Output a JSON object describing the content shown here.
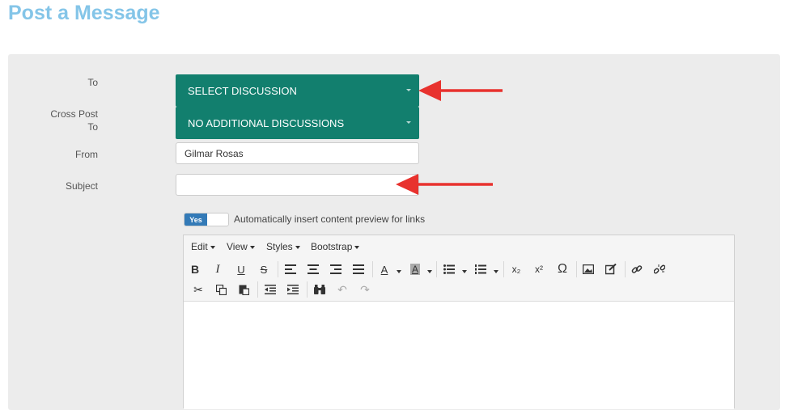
{
  "page": {
    "title": "Post a Message"
  },
  "form": {
    "to_label": "To",
    "cross_post_label_line1": "Cross Post",
    "cross_post_label_line2": "To",
    "from_label": "From",
    "subject_label": "Subject",
    "to_select": "SELECT DISCUSSION",
    "cross_post_select": "NO ADDITIONAL DISCUSSIONS",
    "from_value": "Gilmar Rosas",
    "subject_value": "",
    "toggle_on_label": "Yes",
    "toggle_caption": "Automatically insert content preview for links"
  },
  "editor": {
    "menus": [
      "Edit",
      "View",
      "Styles",
      "Bootstrap"
    ],
    "toolbar_row1": [
      "bold-icon",
      "italic-icon",
      "underline-icon",
      "strikethrough-icon",
      "align-left-icon",
      "align-center-icon",
      "align-right-icon",
      "align-justify-icon",
      "text-color-icon",
      "background-color-icon",
      "bullet-list-icon",
      "numbered-list-icon",
      "subscript-icon",
      "superscript-icon",
      "special-character-icon",
      "image-icon",
      "edit-source-icon",
      "link-icon",
      "unlink-icon"
    ],
    "toolbar_row2": [
      "cut-icon",
      "copy-icon",
      "paste-icon",
      "outdent-icon",
      "indent-icon",
      "find-icon",
      "undo-icon",
      "redo-icon"
    ],
    "glyphs": {
      "bold": "B",
      "italic": "I",
      "underline": "U",
      "strike": "S",
      "text_color": "A",
      "bg_color": "A",
      "subscript": "x₂",
      "superscript": "x²",
      "omega": "Ω"
    }
  },
  "colors": {
    "accent": "#127f6e",
    "title": "#84c5e8",
    "annotation_arrow": "#e8322e",
    "toggle_on": "#337ab7"
  }
}
